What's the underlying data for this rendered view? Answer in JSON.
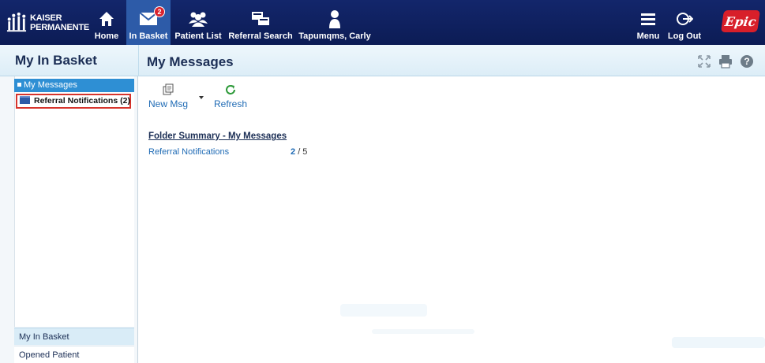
{
  "brand": {
    "line1": "KAISER",
    "line2": "PERMANENTE",
    "epic": "Epic"
  },
  "nav": {
    "home": "Home",
    "in_basket": "In Basket",
    "in_basket_badge": "2",
    "patient_list": "Patient List",
    "referral_search": "Referral Search",
    "user": "Tapumqms, Carly",
    "menu": "Menu",
    "log_out": "Log Out"
  },
  "left_panel": {
    "title": "My In Basket",
    "selected_folder": "My Messages",
    "child_folder": "Referral Notifications (2)",
    "section1": "My In Basket",
    "section2": "Opened Patient"
  },
  "main": {
    "title": "My Messages",
    "new_msg": "New Msg",
    "refresh": "Refresh",
    "summary_title": "Folder Summary - My Messages",
    "summary_rows": [
      {
        "label": "Referral Notifications",
        "unread": "2",
        "total": "/ 5"
      }
    ]
  },
  "colors": {
    "nav_bg": "#0c1c55",
    "active_tab": "#2d5ba8",
    "selected_folder": "#2e8fd4",
    "link": "#1f6bb5",
    "badge": "#d9232e",
    "epic_red": "#d81f2a"
  },
  "icons": {
    "home": "house-icon",
    "in_basket": "envelope-icon",
    "patient_list": "people-icon",
    "referral_search": "referral-search-icon",
    "user": "person-icon",
    "menu": "hamburger-icon",
    "log_out": "logout-icon",
    "expand": "expand-icon",
    "print": "print-icon",
    "help": "help-icon",
    "new_msg": "new-message-icon",
    "refresh": "refresh-icon",
    "folder": "folder-icon"
  }
}
